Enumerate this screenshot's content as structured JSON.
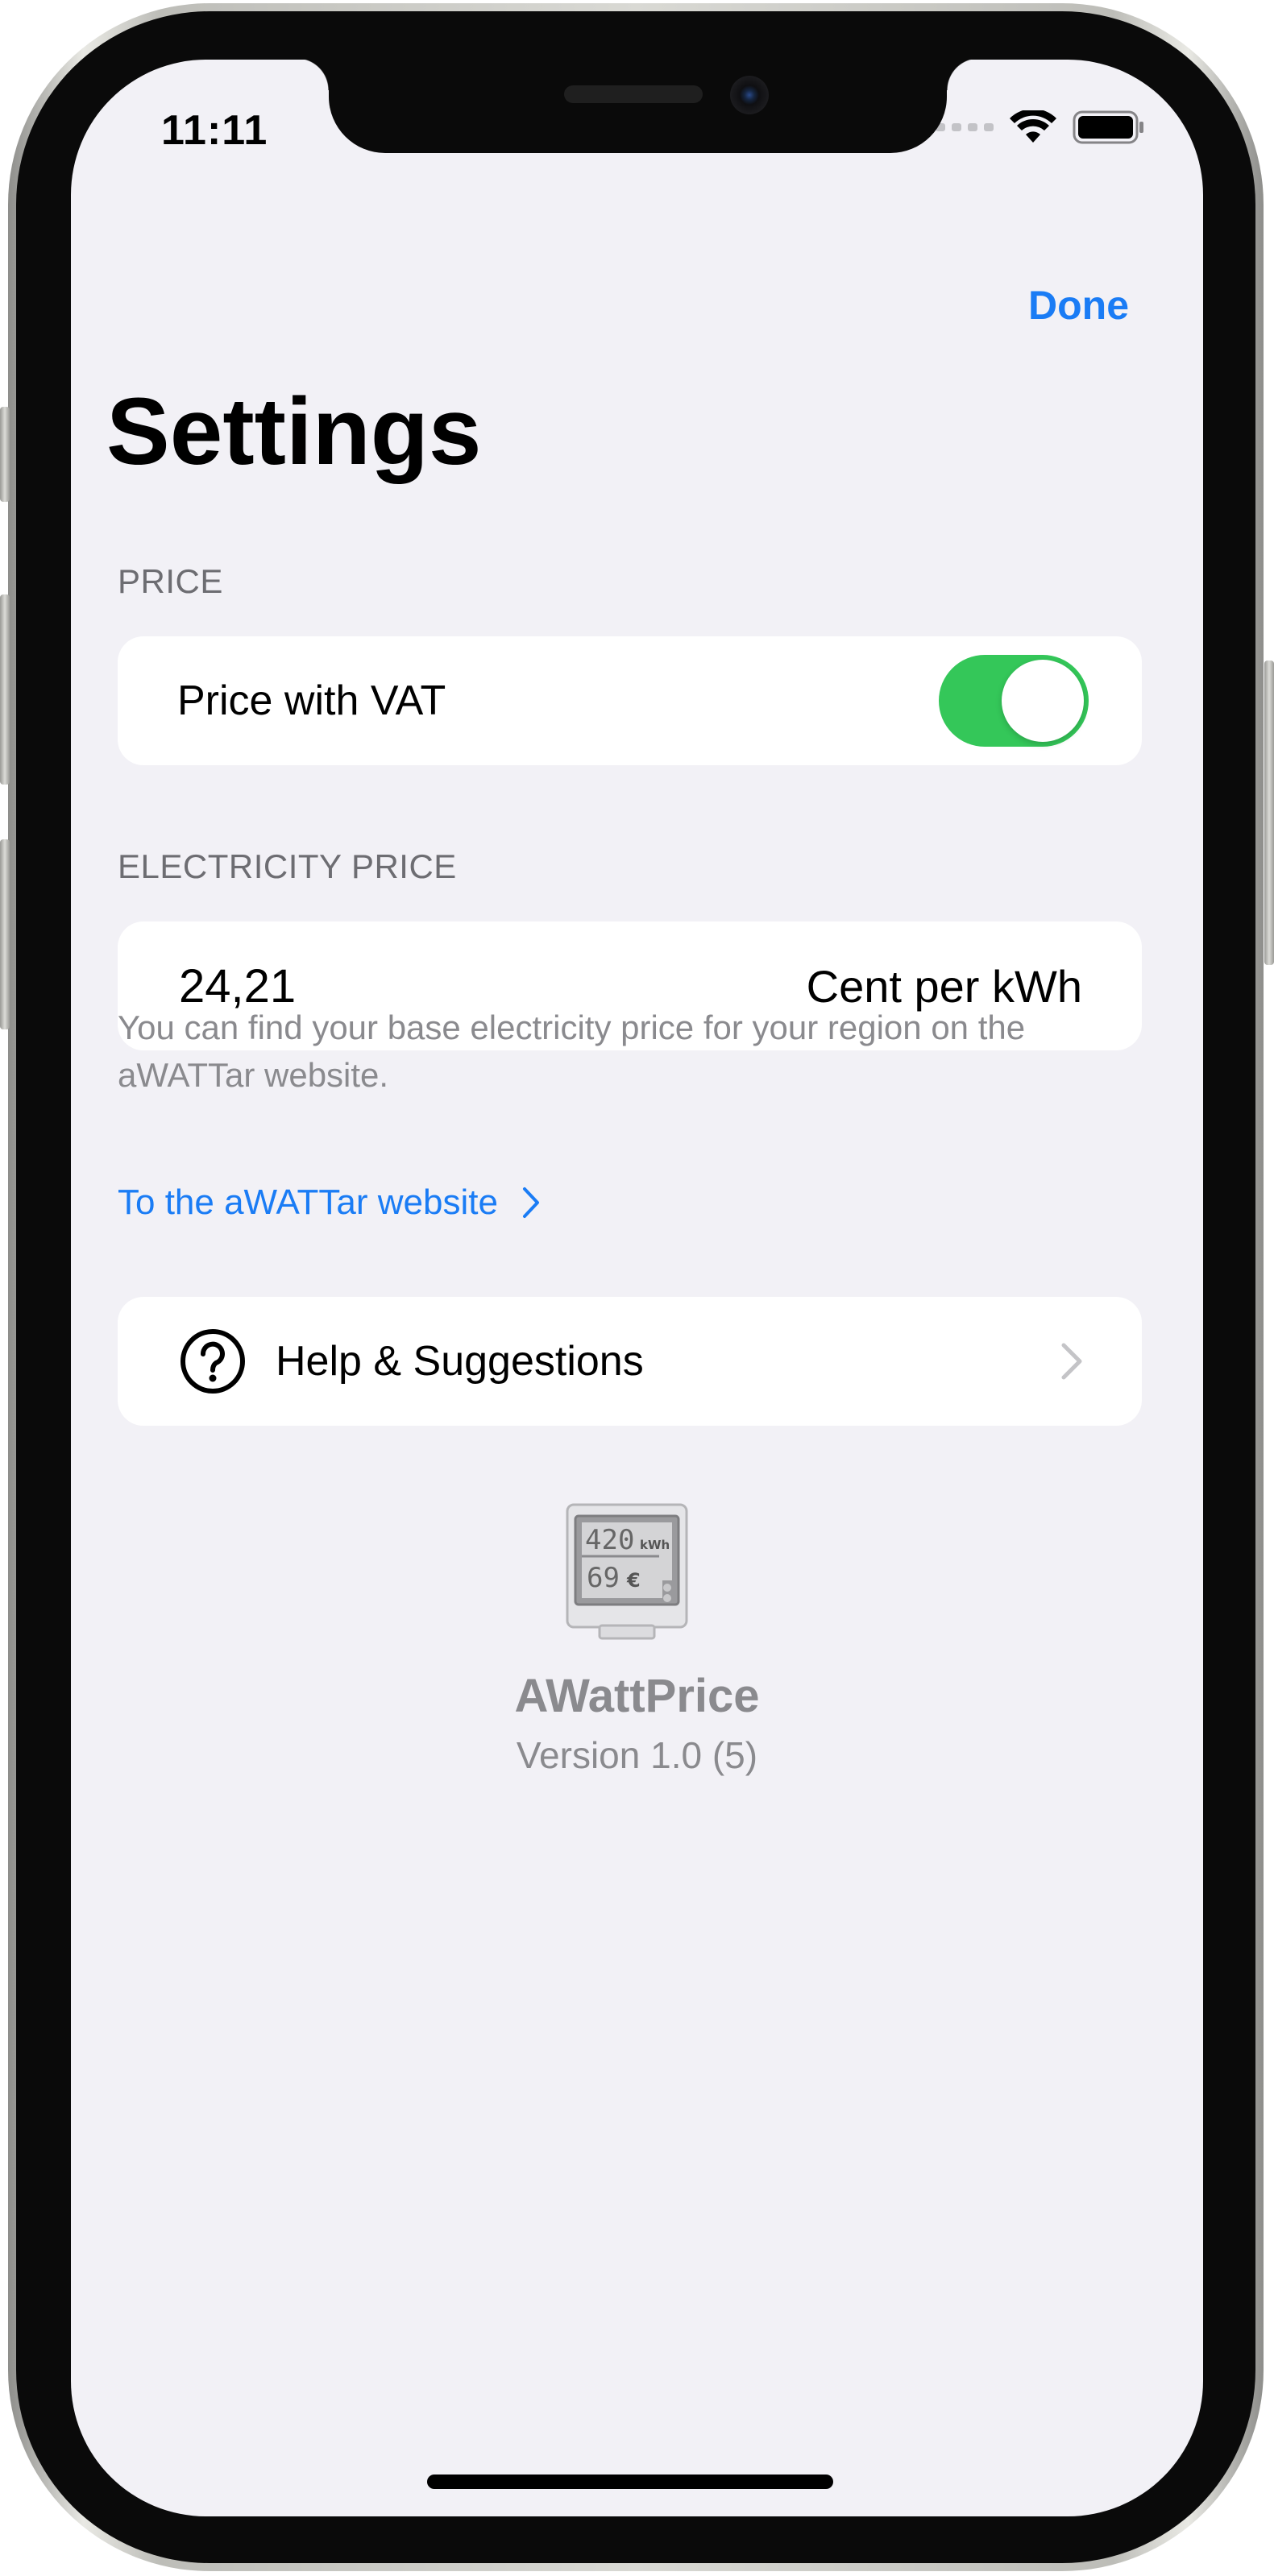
{
  "status_bar": {
    "time": "11:11",
    "icons": [
      "signal-dots",
      "wifi-icon",
      "battery-icon"
    ]
  },
  "nav": {
    "done_label": "Done",
    "title": "Settings"
  },
  "price_section": {
    "header": "PRICE",
    "vat_label": "Price with VAT",
    "vat_enabled": true
  },
  "electricity_section": {
    "header": "ELECTRICITY PRICE",
    "value": "24,21",
    "unit": "Cent per kWh",
    "footer": "You can find your base electricity price for your region on the aWATTar website.",
    "link_label": "To the aWATTar website"
  },
  "help": {
    "label": "Help & Suggestions",
    "icon": "question-circle-icon"
  },
  "app_info": {
    "icon": "meter-app-icon",
    "meter_top": "420",
    "meter_top_unit": "kWh",
    "meter_bottom": "69",
    "meter_bottom_unit": "€",
    "name": "AWattPrice",
    "version": "Version 1.0 (5)"
  },
  "colors": {
    "accent": "#1a7cf5",
    "toggle_on": "#34c759",
    "background": "#f2f1f6",
    "secondary_text": "#8a8a8e"
  }
}
